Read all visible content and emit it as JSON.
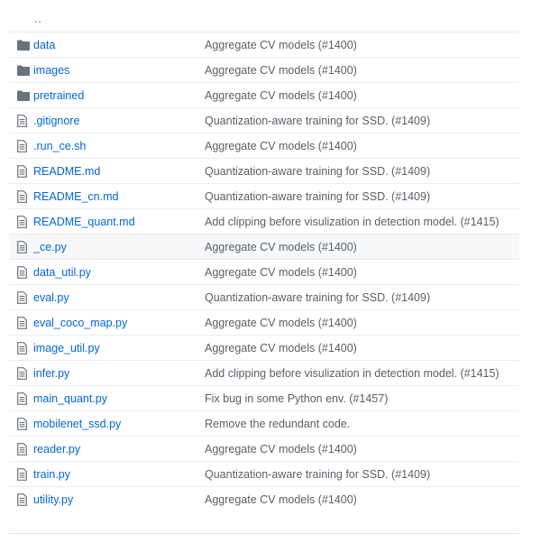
{
  "parent_link": "..",
  "files": [
    {
      "name": "data",
      "type": "folder",
      "message": "Aggregate CV models (#1400)"
    },
    {
      "name": "images",
      "type": "folder",
      "message": "Aggregate CV models (#1400)"
    },
    {
      "name": "pretrained",
      "type": "folder",
      "message": "Aggregate CV models (#1400)"
    },
    {
      "name": ".gitignore",
      "type": "file",
      "message": "Quantization-aware training for SSD. (#1409)"
    },
    {
      "name": ".run_ce.sh",
      "type": "file",
      "message": "Aggregate CV models (#1400)"
    },
    {
      "name": "README.md",
      "type": "file",
      "message": "Quantization-aware training for SSD. (#1409)"
    },
    {
      "name": "README_cn.md",
      "type": "file",
      "message": "Quantization-aware training for SSD. (#1409)"
    },
    {
      "name": "README_quant.md",
      "type": "file",
      "message": "Add clipping before visulization in detection model. (#1415)"
    },
    {
      "name": "_ce.py",
      "type": "file",
      "message": "Aggregate CV models (#1400)"
    },
    {
      "name": "data_util.py",
      "type": "file",
      "message": "Aggregate CV models (#1400)"
    },
    {
      "name": "eval.py",
      "type": "file",
      "message": "Quantization-aware training for SSD. (#1409)"
    },
    {
      "name": "eval_coco_map.py",
      "type": "file",
      "message": "Aggregate CV models (#1400)"
    },
    {
      "name": "image_util.py",
      "type": "file",
      "message": "Aggregate CV models (#1400)"
    },
    {
      "name": "infer.py",
      "type": "file",
      "message": "Add clipping before visulization in detection model. (#1415)"
    },
    {
      "name": "main_quant.py",
      "type": "file",
      "message": "Fix bug in some Python env. (#1457)"
    },
    {
      "name": "mobilenet_ssd.py",
      "type": "file",
      "message": "Remove the redundant code."
    },
    {
      "name": "reader.py",
      "type": "file",
      "message": "Aggregate CV models (#1400)"
    },
    {
      "name": "train.py",
      "type": "file",
      "message": "Quantization-aware training for SSD. (#1409)"
    },
    {
      "name": "utility.py",
      "type": "file",
      "message": "Aggregate CV models (#1400)"
    }
  ],
  "hovered_index": 8,
  "colors": {
    "link": "#0366d6",
    "folder_icon": "#6a737d",
    "file_icon": "#6a737d",
    "message": "#586069",
    "hover_bg": "#f6f8fa"
  },
  "icons": {
    "folder": "folder-icon",
    "file": "file-icon"
  }
}
